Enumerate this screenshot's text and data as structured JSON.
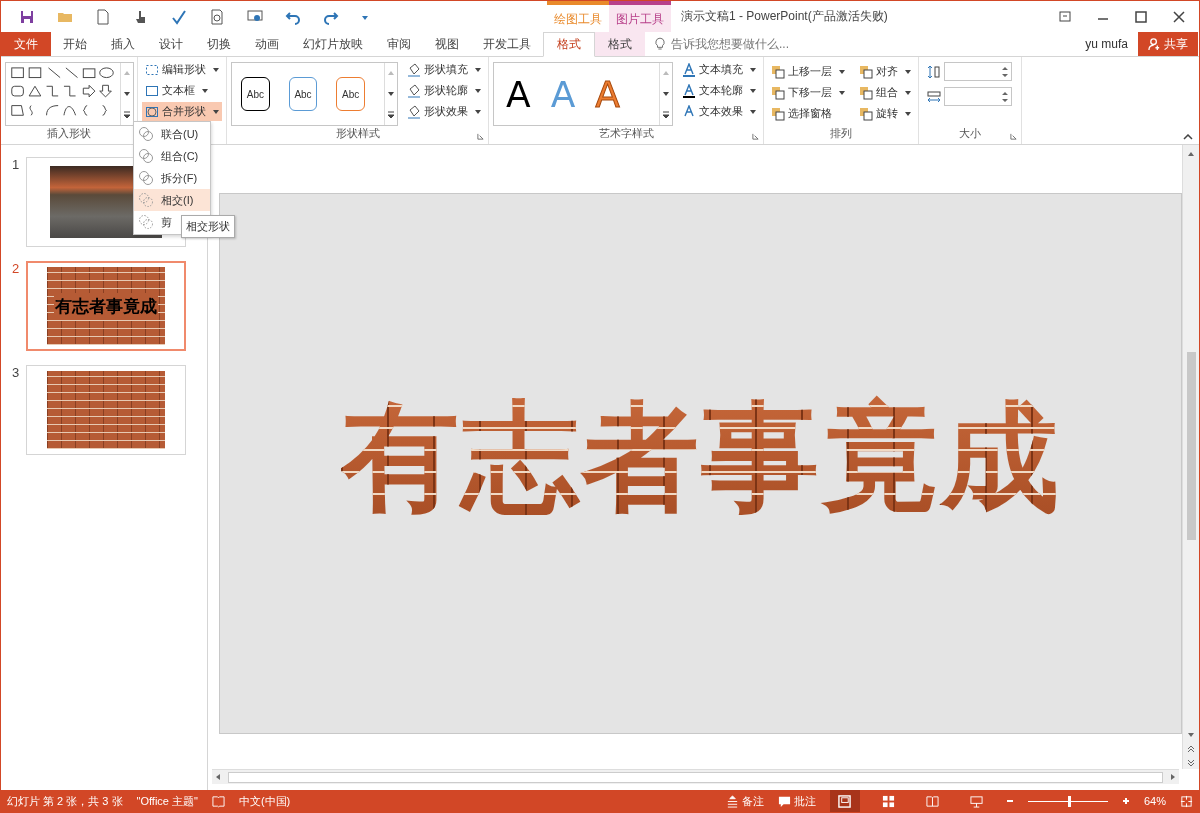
{
  "context_groups": [
    {
      "label": "绘图工具",
      "color": "#e98a2b"
    },
    {
      "label": "图片工具",
      "color": "#b8418a"
    }
  ],
  "window": {
    "title": "演示文稿1 - PowerPoint(产品激活失败)"
  },
  "tabs": [
    {
      "label": "文件",
      "kind": "file",
      "selected": false
    },
    {
      "label": "开始",
      "kind": "plain",
      "selected": false
    },
    {
      "label": "插入",
      "kind": "plain",
      "selected": false
    },
    {
      "label": "设计",
      "kind": "plain",
      "selected": false
    },
    {
      "label": "切换",
      "kind": "plain",
      "selected": false
    },
    {
      "label": "动画",
      "kind": "plain",
      "selected": false
    },
    {
      "label": "幻灯片放映",
      "kind": "plain",
      "selected": false
    },
    {
      "label": "审阅",
      "kind": "plain",
      "selected": false
    },
    {
      "label": "视图",
      "kind": "plain",
      "selected": false
    },
    {
      "label": "开发工具",
      "kind": "plain",
      "selected": false
    },
    {
      "label": "格式",
      "kind": "drawing",
      "selected": true
    },
    {
      "label": "格式",
      "kind": "picture",
      "selected": false
    }
  ],
  "tell_me": {
    "placeholder": "告诉我您想要做什么..."
  },
  "user": "yu mufa",
  "share_button": "共享",
  "ribbon": {
    "insert_shapes": {
      "label": "插入形状",
      "commands": [
        {
          "label": "编辑形状",
          "dropdown": true,
          "expanded": false
        },
        {
          "label": "文本框",
          "dropdown": true,
          "expanded": false
        },
        {
          "label": "合并形状",
          "dropdown": true,
          "expanded": true
        }
      ]
    },
    "shape_styles": {
      "label": "形状样式",
      "samples": [
        {
          "label": "Abc",
          "color": "#000000"
        },
        {
          "label": "Abc",
          "color": "#5b9bd5"
        },
        {
          "label": "Abc",
          "color": "#ed7d31"
        }
      ],
      "commands": [
        {
          "label": "形状填充",
          "dropdown": true
        },
        {
          "label": "形状轮廓",
          "dropdown": true
        },
        {
          "label": "形状效果",
          "dropdown": true
        }
      ]
    },
    "wordart_styles": {
      "label": "艺术字样式",
      "samples": [
        {
          "label": "A",
          "color": "#000000",
          "kind": "fill"
        },
        {
          "label": "A",
          "color": "#5b9bd5",
          "kind": "fill"
        },
        {
          "label": "A",
          "color": "#ed7d31",
          "kind": "outline"
        }
      ],
      "commands": [
        {
          "label": "文本填充",
          "dropdown": true
        },
        {
          "label": "文本轮廓",
          "dropdown": true
        },
        {
          "label": "文本效果",
          "dropdown": true
        }
      ]
    },
    "arrange": {
      "label": "排列",
      "commands": [
        {
          "label": "上移一层",
          "dropdown": true
        },
        {
          "label": "下移一层",
          "dropdown": true
        },
        {
          "label": "选择窗格",
          "dropdown": false
        },
        {
          "label": "对齐",
          "dropdown": true
        },
        {
          "label": "组合",
          "dropdown": true
        },
        {
          "label": "旋转",
          "dropdown": true
        }
      ]
    },
    "size": {
      "label": "大小"
    }
  },
  "merge_menu": {
    "items": [
      {
        "label": "联合(U)",
        "selected": false
      },
      {
        "label": "组合(C)",
        "selected": false
      },
      {
        "label": "拆分(F)",
        "selected": false
      },
      {
        "label": "相交(I)",
        "selected": true
      },
      {
        "label": "剪",
        "selected": false
      }
    ],
    "tooltip": "相交形状"
  },
  "slides": [
    {
      "number": "1",
      "kind": "road-photo",
      "selected": false
    },
    {
      "number": "2",
      "kind": "brick-text",
      "text": "有志者事竟成",
      "selected": true
    },
    {
      "number": "3",
      "kind": "brick",
      "selected": false
    }
  ],
  "slide_text": "有志者事竟成",
  "status_bar": {
    "slide_info": "幻灯片 第 2 张，共 3 张",
    "theme": "\"Office 主题\"",
    "language": "中文(中国)",
    "notes": "备注",
    "comments": "批注",
    "views": [
      {
        "kind": "normal",
        "selected": true
      },
      {
        "kind": "sorter",
        "selected": false
      },
      {
        "kind": "reading",
        "selected": false
      },
      {
        "kind": "show",
        "selected": false
      }
    ],
    "zoom": {
      "level": 0.5,
      "reading": "64%"
    }
  }
}
